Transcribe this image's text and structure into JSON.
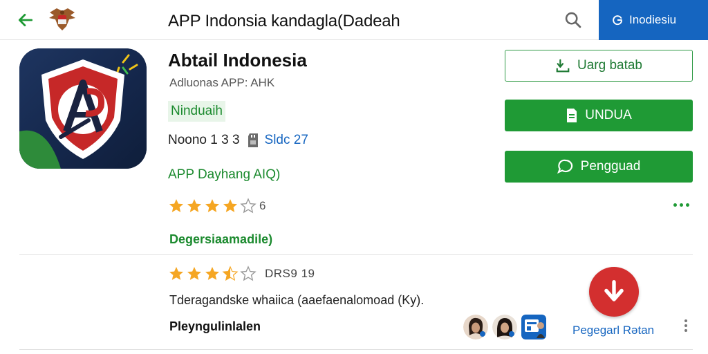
{
  "topbar": {
    "title": "APP Indonsia kandagla(Dadeah",
    "lang_label": "Inodiesiu",
    "back_icon": "arrow-left-icon",
    "search_icon": "search-icon"
  },
  "app": {
    "name": "Abtail Indonesia",
    "subtitle": "Adluonas APP: AHK",
    "badge": "Ninduaih",
    "version": "Noono 1 3 3",
    "size": "Sldc 27",
    "developer": "APP Dayhang AIQ)",
    "rating_stars": 4,
    "rating_count": "6",
    "category": "Degersiaamadile)"
  },
  "actions": {
    "primary_outline": "Uarg batab",
    "download": "UNDUA",
    "review": "Pengguad"
  },
  "review": {
    "stars": 3.5,
    "date": "DRS9 19",
    "text": "Tderagandske whaiica (aaefaenalomoad (Ky).",
    "reviewer": "Pleyngulinlalen",
    "download_label": "Pegegarl Rətan"
  },
  "colors": {
    "accent_blue": "#1565c0",
    "accent_green": "#1f9a35",
    "download_red": "#d32f2f",
    "star": "#f5a623"
  }
}
